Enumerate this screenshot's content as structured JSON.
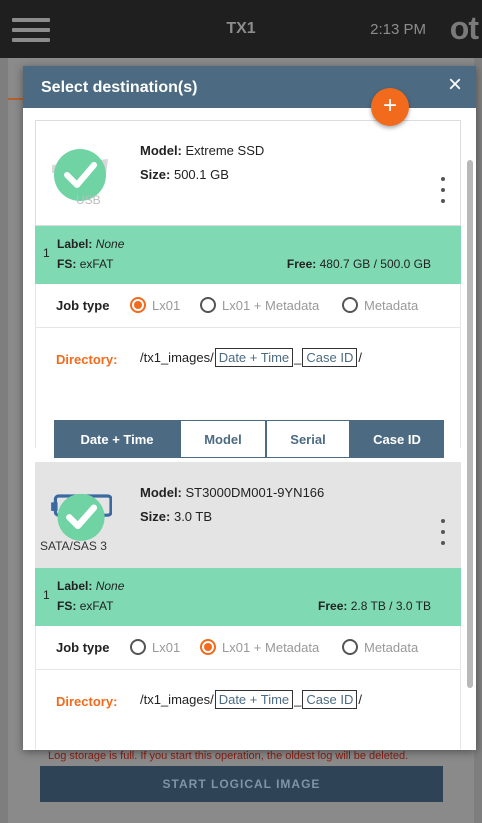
{
  "appbar": {
    "title": "TX1",
    "time": "2:13 PM",
    "logo": "ot"
  },
  "background": {
    "warning": "Log storage is full. If you start this operation, the oldest log will be deleted.",
    "start_button": "START LOGICAL IMAGE"
  },
  "dialog": {
    "title": "Select destination(s)",
    "close": "×",
    "add": "+",
    "devices": [
      {
        "type_caption": "USB",
        "model_key": "Model:",
        "model": "Extreme SSD",
        "size_key": "Size:",
        "size": "500.1 GB",
        "partition": {
          "num": "1",
          "label_key": "Label:",
          "label": "None",
          "fs_key": "FS:",
          "fs": "exFAT",
          "free_key": "Free:",
          "free": "480.7 GB / 500.0 GB"
        },
        "job_type_label": "Job type",
        "job_options": [
          "Lx01",
          "Lx01 + Metadata",
          "Metadata"
        ],
        "job_selected": "Lx01",
        "directory_label": "Directory:",
        "directory_prefix": "/tx1_images/",
        "dir_token1": "Date + Time",
        "dir_sep": "_",
        "dir_token2": "Case ID",
        "dir_suffix": "/",
        "name_buttons": [
          "Date + Time",
          "Model",
          "Serial",
          "Case ID"
        ],
        "name_buttons_active": [
          "Date + Time",
          "Case ID"
        ]
      },
      {
        "type_caption": "SATA/SAS 3",
        "model_key": "Model:",
        "model": "ST3000DM001-9YN166",
        "size_key": "Size:",
        "size": "3.0 TB",
        "partition": {
          "num": "1",
          "label_key": "Label:",
          "label": "None",
          "fs_key": "FS:",
          "fs": "exFAT",
          "free_key": "Free:",
          "free": "2.8 TB / 3.0 TB"
        },
        "job_type_label": "Job type",
        "job_options": [
          "Lx01",
          "Lx01 + Metadata",
          "Metadata"
        ],
        "job_selected": "Lx01 + Metadata",
        "directory_label": "Directory:",
        "directory_prefix": "/tx1_images/",
        "dir_token1": "Date + Time",
        "dir_sep": "_",
        "dir_token2": "Case ID",
        "dir_suffix": "/"
      }
    ]
  },
  "colors": {
    "accent": "#f26a1b",
    "header": "#4c6b82",
    "partition": "#7fd9b2",
    "check": "#6fd3a4"
  }
}
